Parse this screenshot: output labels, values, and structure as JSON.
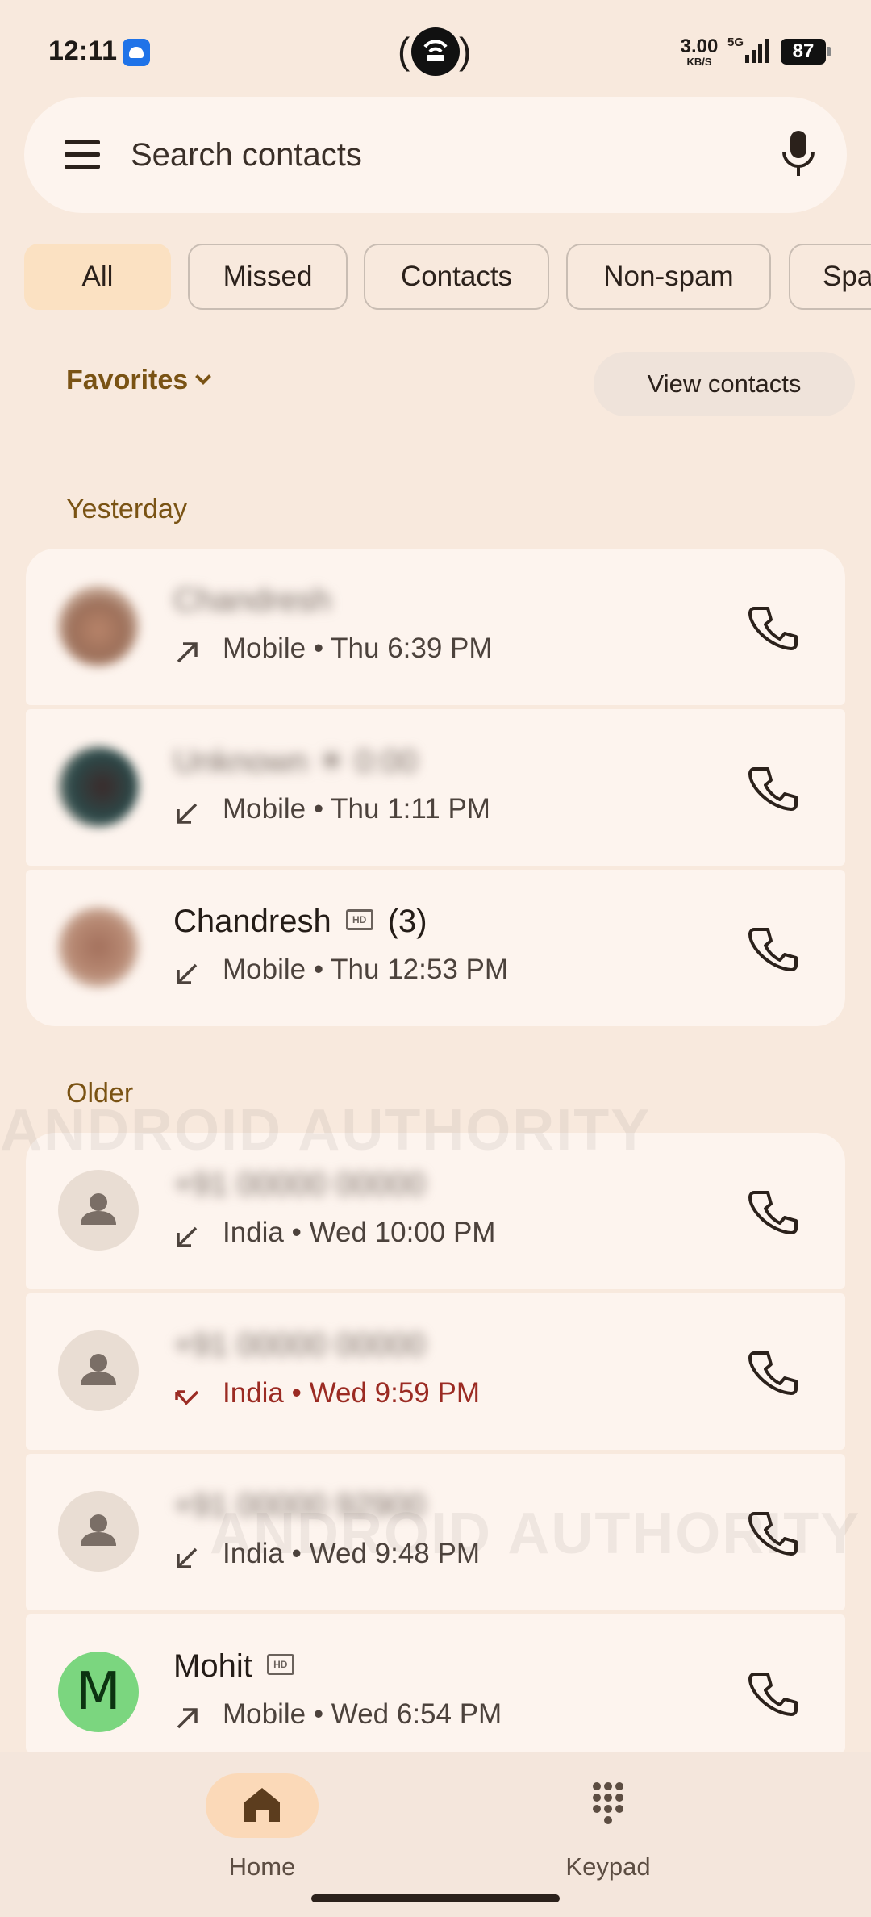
{
  "status_bar": {
    "time": "12:11",
    "speed_value": "3.00",
    "speed_unit": "KB/S",
    "network": "5G",
    "battery": "87"
  },
  "search": {
    "placeholder": "Search contacts"
  },
  "filters": [
    {
      "label": "All",
      "selected": true
    },
    {
      "label": "Missed",
      "selected": false
    },
    {
      "label": "Contacts",
      "selected": false
    },
    {
      "label": "Non-spam",
      "selected": false
    },
    {
      "label": "Spa",
      "selected": false
    }
  ],
  "favorites": {
    "label": "Favorites",
    "view_contacts_label": "View contacts"
  },
  "sections": {
    "yesterday": "Yesterday",
    "older": "Older"
  },
  "calls": [
    {
      "name": "Chandresh",
      "hd": false,
      "count": "",
      "direction": "outgoing",
      "meta": "Mobile • Thu 6:39 PM",
      "missed": false,
      "name_blurred": true
    },
    {
      "name": "Unknown ☀ 0:00",
      "hd": false,
      "count": "",
      "direction": "incoming",
      "meta": "Mobile • Thu 1:11 PM",
      "missed": false,
      "name_blurred": true
    },
    {
      "name": "Chandresh",
      "hd": true,
      "count": "(3)",
      "direction": "incoming",
      "meta": "Mobile • Thu 12:53 PM",
      "missed": false,
      "name_blurred": false
    },
    {
      "name": "+91 00000 00000",
      "hd": false,
      "count": "",
      "direction": "incoming",
      "meta": "India • Wed 10:00 PM",
      "missed": false,
      "name_blurred": true
    },
    {
      "name": "+91 00000 00000",
      "hd": false,
      "count": "",
      "direction": "missed",
      "meta": "India • Wed 9:59 PM",
      "missed": true,
      "name_blurred": true
    },
    {
      "name": "+91 00000 92900",
      "hd": false,
      "count": "",
      "direction": "incoming",
      "meta": "India • Wed 9:48 PM",
      "missed": false,
      "name_blurred": true
    },
    {
      "name": "Mohit",
      "hd": true,
      "count": "",
      "direction": "outgoing",
      "meta": "Mobile • Wed 6:54 PM",
      "missed": false,
      "name_blurred": false,
      "avatar_letter": "M"
    }
  ],
  "nav": {
    "home_label": "Home",
    "keypad_label": "Keypad"
  },
  "watermark": "ANDROID AUTHORITY",
  "colors": {
    "background": "#f8e9dd",
    "card": "#fdf4ee",
    "accent": "#7a5314",
    "chip_selected": "#fbe1c2",
    "missed_red": "#9b2b23",
    "avatar_green": "#7bd67f"
  }
}
